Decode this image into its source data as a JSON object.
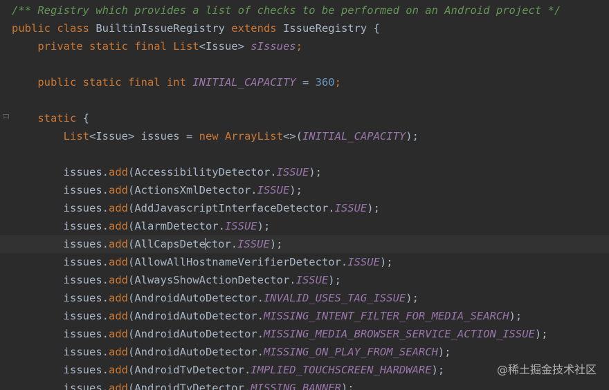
{
  "editor": {
    "colors": {
      "background": "#2b2b2b",
      "keyword": "#cc7832",
      "identifier": "#a9b7c6",
      "static_field": "#9876aa",
      "number": "#6897bb",
      "doc_comment": "#629755",
      "current_line": "#323232"
    },
    "gutter": {
      "fold_icon": "fold-collapse-icon"
    },
    "lines": [
      {
        "tokens": [
          {
            "t": "/** Registry which provides a list of checks to be performed on an Android project */",
            "c": "comment"
          }
        ]
      },
      {
        "tokens": [
          {
            "t": "public class ",
            "c": "kw"
          },
          {
            "t": "BuiltinIssueRegistry ",
            "c": "plain"
          },
          {
            "t": "extends ",
            "c": "kw"
          },
          {
            "t": "IssueRegistry {",
            "c": "plain"
          }
        ]
      },
      {
        "tokens": [
          {
            "t": "    private static final ",
            "c": "kw"
          },
          {
            "t": "List",
            "c": "kw"
          },
          {
            "t": "<Issue> ",
            "c": "plain"
          },
          {
            "t": "sIssues",
            "c": "field"
          },
          {
            "t": ";",
            "c": "kw"
          }
        ]
      },
      {
        "tokens": []
      },
      {
        "tokens": [
          {
            "t": "    public static final int ",
            "c": "kw"
          },
          {
            "t": "INITIAL_CAPACITY",
            "c": "field"
          },
          {
            "t": " = ",
            "c": "plain"
          },
          {
            "t": "360",
            "c": "num"
          },
          {
            "t": ";",
            "c": "kw"
          }
        ]
      },
      {
        "tokens": []
      },
      {
        "tokens": [
          {
            "t": "    static ",
            "c": "kw"
          },
          {
            "t": "{",
            "c": "plain"
          }
        ]
      },
      {
        "tokens": [
          {
            "t": "        ",
            "c": "plain"
          },
          {
            "t": "List",
            "c": "kw"
          },
          {
            "t": "<Issue> issues = ",
            "c": "plain"
          },
          {
            "t": "new ",
            "c": "kw"
          },
          {
            "t": "ArrayList",
            "c": "kw"
          },
          {
            "t": "<>(",
            "c": "plain"
          },
          {
            "t": "INITIAL_CAPACITY",
            "c": "field"
          },
          {
            "t": ");",
            "c": "plain"
          }
        ]
      },
      {
        "tokens": []
      },
      {
        "tokens": [
          {
            "t": "        issues.",
            "c": "plain"
          },
          {
            "t": "add",
            "c": "kw"
          },
          {
            "t": "(AccessibilityDetector.",
            "c": "plain"
          },
          {
            "t": "ISSUE",
            "c": "field"
          },
          {
            "t": ");",
            "c": "plain"
          }
        ]
      },
      {
        "tokens": [
          {
            "t": "        issues.",
            "c": "plain"
          },
          {
            "t": "add",
            "c": "kw"
          },
          {
            "t": "(ActionsXmlDetector.",
            "c": "plain"
          },
          {
            "t": "ISSUE",
            "c": "field"
          },
          {
            "t": ");",
            "c": "plain"
          }
        ]
      },
      {
        "tokens": [
          {
            "t": "        issues.",
            "c": "plain"
          },
          {
            "t": "add",
            "c": "kw"
          },
          {
            "t": "(AddJavascriptInterfaceDetector.",
            "c": "plain"
          },
          {
            "t": "ISSUE",
            "c": "field"
          },
          {
            "t": ");",
            "c": "plain"
          }
        ]
      },
      {
        "tokens": [
          {
            "t": "        issues.",
            "c": "plain"
          },
          {
            "t": "add",
            "c": "kw"
          },
          {
            "t": "(AlarmDetector.",
            "c": "plain"
          },
          {
            "t": "ISSUE",
            "c": "field"
          },
          {
            "t": ");",
            "c": "plain"
          }
        ]
      },
      {
        "current": true,
        "caret_after": "        issues.add(AllCapsDete",
        "tokens": [
          {
            "t": "        issues.",
            "c": "plain"
          },
          {
            "t": "add",
            "c": "kw"
          },
          {
            "t": "(AllCapsDete",
            "c": "plain"
          },
          {
            "t": "ctor.",
            "c": "plain"
          },
          {
            "t": "ISSUE",
            "c": "field"
          },
          {
            "t": ");",
            "c": "plain"
          }
        ]
      },
      {
        "tokens": [
          {
            "t": "        issues.",
            "c": "plain"
          },
          {
            "t": "add",
            "c": "kw"
          },
          {
            "t": "(AllowAllHostnameVerifierDetector.",
            "c": "plain"
          },
          {
            "t": "ISSUE",
            "c": "field"
          },
          {
            "t": ");",
            "c": "plain"
          }
        ]
      },
      {
        "tokens": [
          {
            "t": "        issues.",
            "c": "plain"
          },
          {
            "t": "add",
            "c": "kw"
          },
          {
            "t": "(AlwaysShowActionDetector.",
            "c": "plain"
          },
          {
            "t": "ISSUE",
            "c": "field"
          },
          {
            "t": ");",
            "c": "plain"
          }
        ]
      },
      {
        "tokens": [
          {
            "t": "        issues.",
            "c": "plain"
          },
          {
            "t": "add",
            "c": "kw"
          },
          {
            "t": "(AndroidAutoDetector.",
            "c": "plain"
          },
          {
            "t": "INVALID_USES_TAG_ISSUE",
            "c": "field"
          },
          {
            "t": ");",
            "c": "plain"
          }
        ]
      },
      {
        "tokens": [
          {
            "t": "        issues.",
            "c": "plain"
          },
          {
            "t": "add",
            "c": "kw"
          },
          {
            "t": "(AndroidAutoDetector.",
            "c": "plain"
          },
          {
            "t": "MISSING_INTENT_FILTER_FOR_MEDIA_SEARCH",
            "c": "field"
          },
          {
            "t": ");",
            "c": "plain"
          }
        ]
      },
      {
        "tokens": [
          {
            "t": "        issues.",
            "c": "plain"
          },
          {
            "t": "add",
            "c": "kw"
          },
          {
            "t": "(AndroidAutoDetector.",
            "c": "plain"
          },
          {
            "t": "MISSING_MEDIA_BROWSER_SERVICE_ACTION_ISSUE",
            "c": "field"
          },
          {
            "t": ");",
            "c": "plain"
          }
        ]
      },
      {
        "tokens": [
          {
            "t": "        issues.",
            "c": "plain"
          },
          {
            "t": "add",
            "c": "kw"
          },
          {
            "t": "(AndroidAutoDetector.",
            "c": "plain"
          },
          {
            "t": "MISSING_ON_PLAY_FROM_SEARCH",
            "c": "field"
          },
          {
            "t": ");",
            "c": "plain"
          }
        ]
      },
      {
        "tokens": [
          {
            "t": "        issues.",
            "c": "plain"
          },
          {
            "t": "add",
            "c": "kw"
          },
          {
            "t": "(AndroidTvDetector.",
            "c": "plain"
          },
          {
            "t": "IMPLIED_TOUCHSCREEN_HARDWARE",
            "c": "field"
          },
          {
            "t": ");",
            "c": "plain"
          }
        ]
      },
      {
        "tokens": [
          {
            "t": "        issues.",
            "c": "plain"
          },
          {
            "t": "add",
            "c": "kw"
          },
          {
            "t": "(AndroidTvDetector.",
            "c": "plain"
          },
          {
            "t": "MISSING_BANNER",
            "c": "field"
          },
          {
            "t": ");",
            "c": "plain"
          }
        ]
      }
    ]
  },
  "watermark": {
    "text": "@稀土掘金技术社区"
  }
}
